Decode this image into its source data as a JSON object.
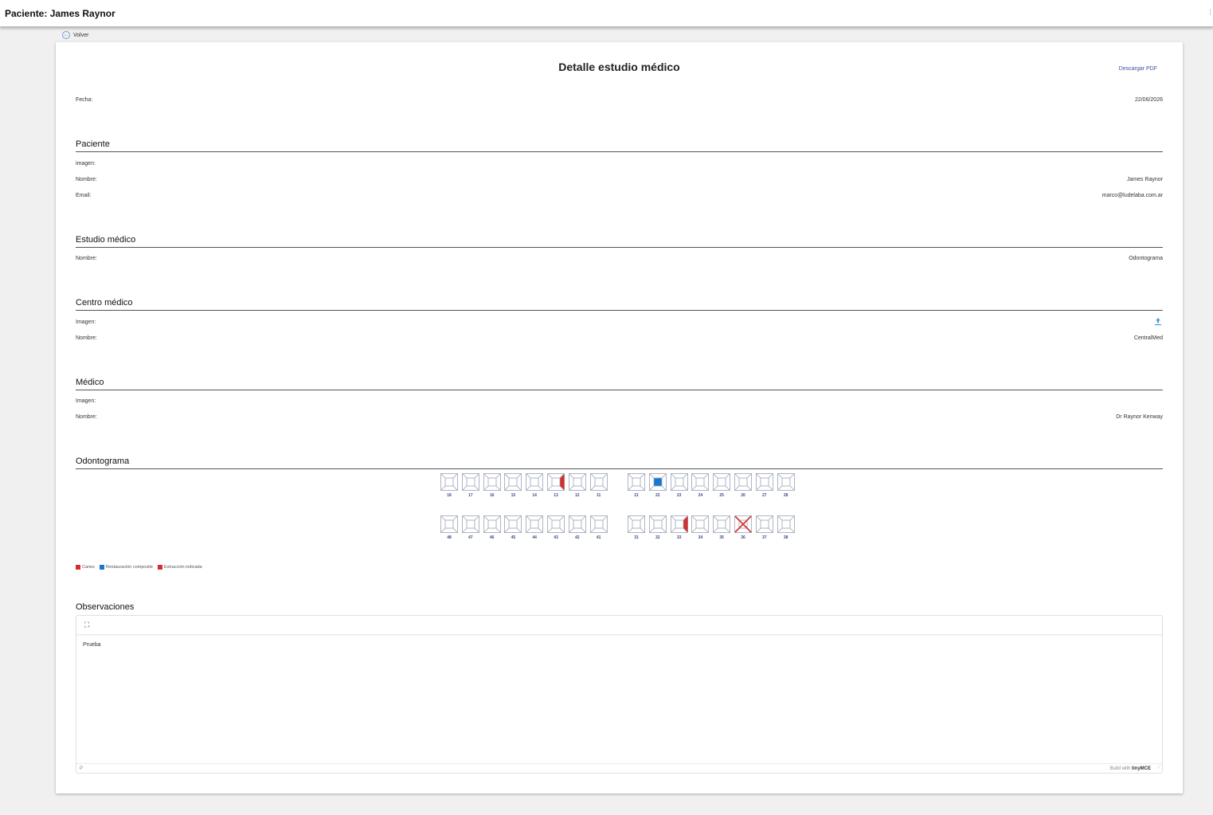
{
  "header": {
    "title": "Paciente: James Raynor"
  },
  "nav": {
    "back_label": "Volver"
  },
  "page": {
    "title": "Detalle estudio médico",
    "download_pdf": "Descargar PDF",
    "fecha_label": "Fecha:",
    "fecha_value": "22/06/2026"
  },
  "paciente": {
    "heading": "Paciente",
    "imagen_label": "imagen:",
    "nombre_label": "Nombre:",
    "nombre_value": "James Raynor",
    "email_label": "Email:",
    "email_value": "marco@ludelaba.com.ar"
  },
  "estudio": {
    "heading": "Estudio médico",
    "nombre_label": "Nombre:",
    "nombre_value": "Odontograma"
  },
  "centro": {
    "heading": "Centro médico",
    "imagen_label": "Imagen:",
    "nombre_label": "Nombre:",
    "nombre_value": "CentralMed",
    "upload_icon": "upload-icon"
  },
  "medico": {
    "heading": "Médico",
    "imagen_label": "Imagen:",
    "nombre_label": "Nombre:",
    "nombre_value": "Dr Raynor Kenway"
  },
  "odontograma": {
    "heading": "Odontograma",
    "upper_left": [
      "18",
      "17",
      "16",
      "15",
      "14",
      "13",
      "12",
      "11"
    ],
    "upper_right": [
      "21",
      "22",
      "23",
      "24",
      "25",
      "26",
      "27",
      "28"
    ],
    "lower_left": [
      "48",
      "47",
      "46",
      "45",
      "44",
      "43",
      "42",
      "41"
    ],
    "lower_right": [
      "31",
      "32",
      "33",
      "34",
      "35",
      "36",
      "37",
      "38"
    ],
    "marks": [
      {
        "tooth": "13",
        "face": "right",
        "condition": "caries"
      },
      {
        "tooth": "22",
        "face": "center",
        "condition": "restauracion"
      },
      {
        "tooth": "33",
        "face": "right",
        "condition": "caries"
      },
      {
        "tooth": "36",
        "face": "all",
        "condition": "extraccion"
      }
    ],
    "legend": [
      {
        "label": "Caries",
        "color": "#d32f2f"
      },
      {
        "label": "Restauración composite",
        "color": "#1976d2"
      },
      {
        "label": "Extracción indicada",
        "color": "#d32f2f"
      }
    ]
  },
  "observaciones": {
    "heading": "Observaciones",
    "content": "Prueba",
    "status_path": "P",
    "brand_prefix": "Build with",
    "brand_name": "tinyMCE"
  }
}
